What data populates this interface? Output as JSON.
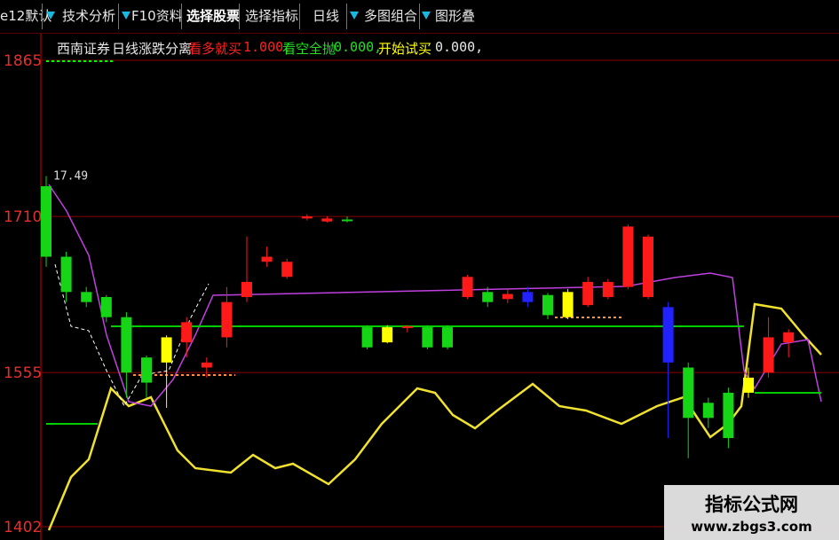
{
  "toolbar": {
    "items": [
      {
        "label": "e12默认"
      },
      {
        "label": "技术分析"
      },
      {
        "label": "F10资料"
      },
      {
        "label": "选择股票"
      },
      {
        "label": "选择指标"
      },
      {
        "label": "日线"
      },
      {
        "label": "多图组合"
      },
      {
        "label": "图形叠加"
      }
    ]
  },
  "legend": {
    "stock_name": "西南证券",
    "period": "日线",
    "indicator_name": "涨跌分离",
    "buy_label": "看多就买",
    "buy_value": "1.000,",
    "sell_label": "看空全抛",
    "sell_value": "0.000,",
    "trial_label": "开始试买",
    "trial_value": "0.000,"
  },
  "watermark": {
    "title": "指标公式网",
    "url": "www.zbgs3.com"
  },
  "colors": {
    "up": "#ff1a1a",
    "down": "#16d416",
    "flat": "#ffff00",
    "special": "#2222ff",
    "grid": "#8a0000",
    "yellow_line": "#f0e030",
    "magenta_line": "#c040e0",
    "green_line": "#00cc00",
    "axis_label": "#e03030"
  },
  "chart_data": {
    "type": "candlestick",
    "y_axis_labels": [
      "1865",
      "1710",
      "1555",
      "1402"
    ],
    "ylim": [
      1402,
      1865
    ],
    "high_annotation": "17.49",
    "grid": true,
    "candles": [
      {
        "x": 1,
        "o": 1740,
        "c": 1670,
        "h": 1750,
        "l": 1660,
        "color": "down"
      },
      {
        "x": 2,
        "o": 1670,
        "c": 1635,
        "h": 1675,
        "l": 1625,
        "color": "down"
      },
      {
        "x": 3,
        "o": 1635,
        "c": 1625,
        "h": 1640,
        "l": 1620,
        "color": "down"
      },
      {
        "x": 4,
        "o": 1630,
        "c": 1610,
        "h": 1632,
        "l": 1605,
        "color": "down"
      },
      {
        "x": 5,
        "o": 1610,
        "c": 1555,
        "h": 1615,
        "l": 1530,
        "color": "down"
      },
      {
        "x": 6,
        "o": 1570,
        "c": 1545,
        "h": 1572,
        "l": 1530,
        "color": "down"
      },
      {
        "x": 7,
        "o": 1565,
        "c": 1590,
        "h": 1592,
        "l": 1520,
        "color": "flat"
      },
      {
        "x": 8,
        "o": 1585,
        "c": 1605,
        "h": 1610,
        "l": 1570,
        "color": "up"
      },
      {
        "x": 9,
        "o": 1560,
        "c": 1565,
        "h": 1570,
        "l": 1550,
        "color": "up"
      },
      {
        "x": 10,
        "o": 1590,
        "c": 1625,
        "h": 1640,
        "l": 1580,
        "color": "up"
      },
      {
        "x": 11,
        "o": 1630,
        "c": 1645,
        "h": 1690,
        "l": 1625,
        "color": "up"
      },
      {
        "x": 12,
        "o": 1665,
        "c": 1670,
        "h": 1680,
        "l": 1660,
        "color": "up"
      },
      {
        "x": 13,
        "o": 1650,
        "c": 1665,
        "h": 1668,
        "l": 1648,
        "color": "up"
      },
      {
        "x": 14,
        "o": 1708,
        "c": 1710,
        "h": 1712,
        "l": 1706,
        "color": "up"
      },
      {
        "x": 15,
        "o": 1705,
        "c": 1708,
        "h": 1710,
        "l": 1704,
        "color": "up"
      },
      {
        "x": 16,
        "o": 1706,
        "c": 1707,
        "h": 1710,
        "l": 1704,
        "color": "down"
      },
      {
        "x": 17,
        "o": 1580,
        "c": 1600,
        "h": 1602,
        "l": 1578,
        "color": "down"
      },
      {
        "x": 18,
        "o": 1585,
        "c": 1600,
        "h": 1602,
        "l": 1584,
        "color": "flat"
      },
      {
        "x": 19,
        "o": 1600,
        "c": 1601,
        "h": 1602,
        "l": 1595,
        "color": "up"
      },
      {
        "x": 20,
        "o": 1580,
        "c": 1600,
        "h": 1602,
        "l": 1578,
        "color": "down"
      },
      {
        "x": 21,
        "o": 1580,
        "c": 1600,
        "h": 1602,
        "l": 1578,
        "color": "down"
      },
      {
        "x": 22,
        "o": 1630,
        "c": 1650,
        "h": 1652,
        "l": 1628,
        "color": "up"
      },
      {
        "x": 23,
        "o": 1625,
        "c": 1635,
        "h": 1640,
        "l": 1620,
        "color": "down"
      },
      {
        "x": 24,
        "o": 1628,
        "c": 1633,
        "h": 1638,
        "l": 1624,
        "color": "up"
      },
      {
        "x": 25,
        "o": 1635,
        "c": 1625,
        "h": 1640,
        "l": 1620,
        "color": "special"
      },
      {
        "x": 26,
        "o": 1632,
        "c": 1612,
        "h": 1634,
        "l": 1608,
        "color": "down"
      },
      {
        "x": 27,
        "o": 1610,
        "c": 1635,
        "h": 1638,
        "l": 1608,
        "color": "flat"
      },
      {
        "x": 28,
        "o": 1622,
        "c": 1645,
        "h": 1650,
        "l": 1620,
        "color": "up"
      },
      {
        "x": 29,
        "o": 1630,
        "c": 1645,
        "h": 1648,
        "l": 1628,
        "color": "up"
      },
      {
        "x": 30,
        "o": 1640,
        "c": 1700,
        "h": 1702,
        "l": 1638,
        "color": "up"
      },
      {
        "x": 31,
        "o": 1630,
        "c": 1690,
        "h": 1692,
        "l": 1628,
        "color": "up"
      },
      {
        "x": 32,
        "o": 1620,
        "c": 1565,
        "h": 1625,
        "l": 1490,
        "color": "special"
      },
      {
        "x": 33,
        "o": 1560,
        "c": 1510,
        "h": 1565,
        "l": 1470,
        "color": "down"
      },
      {
        "x": 34,
        "o": 1525,
        "c": 1510,
        "h": 1530,
        "l": 1500,
        "color": "down"
      },
      {
        "x": 35,
        "o": 1535,
        "c": 1490,
        "h": 1540,
        "l": 1480,
        "color": "down"
      },
      {
        "x": 36,
        "o": 1535,
        "c": 1550,
        "h": 1560,
        "l": 1530,
        "color": "flat"
      },
      {
        "x": 37,
        "o": 1555,
        "c": 1590,
        "h": 1610,
        "l": 1550,
        "color": "up"
      },
      {
        "x": 38,
        "o": 1585,
        "c": 1595,
        "h": 1598,
        "l": 1570,
        "color": "up"
      }
    ]
  }
}
